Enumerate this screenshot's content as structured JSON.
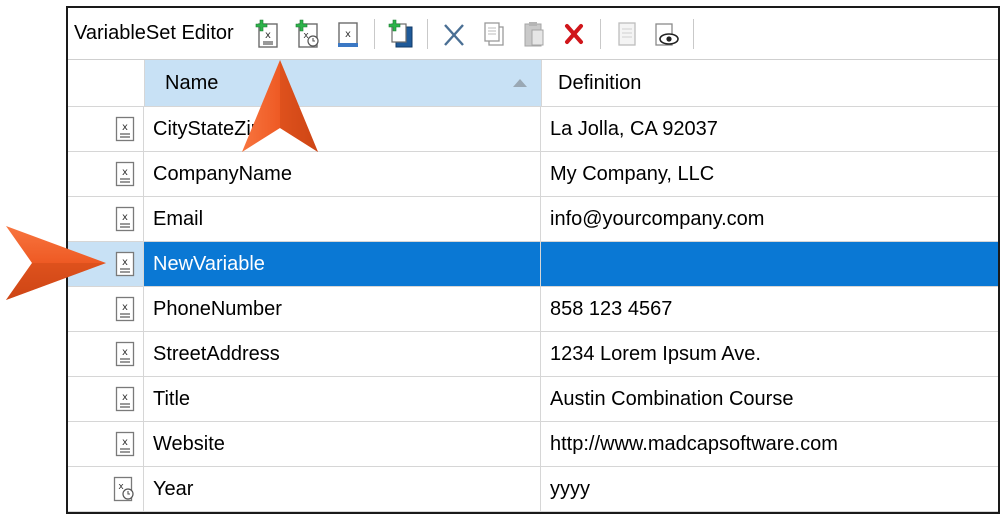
{
  "editor": {
    "title": "VariableSet Editor"
  },
  "toolbar": {
    "buttons": [
      {
        "icon": "add-variable-icon"
      },
      {
        "icon": "add-datetime-variable-icon"
      },
      {
        "icon": "edit-variable-icon"
      },
      {
        "icon": "import-variables-icon"
      },
      {
        "icon": "cut-icon"
      },
      {
        "icon": "copy-icon"
      },
      {
        "icon": "paste-icon"
      },
      {
        "icon": "delete-icon"
      },
      {
        "icon": "properties-icon"
      },
      {
        "icon": "preview-icon"
      }
    ]
  },
  "table": {
    "columns": {
      "name": "Name",
      "definition": "Definition"
    },
    "sorted_column": "Name",
    "sort_direction": "ascending",
    "rows": [
      {
        "name": "CityStateZip",
        "definition": "La Jolla, CA 92037",
        "icon": "text-variable-icon"
      },
      {
        "name": "CompanyName",
        "definition": "My Company, LLC",
        "icon": "text-variable-icon"
      },
      {
        "name": "Email",
        "definition": "info@yourcompany.com",
        "icon": "text-variable-icon"
      },
      {
        "name": "NewVariable",
        "definition": "",
        "icon": "text-variable-icon",
        "selected": true
      },
      {
        "name": "PhoneNumber",
        "definition": "858 123 4567",
        "icon": "text-variable-icon"
      },
      {
        "name": "StreetAddress",
        "definition": "1234 Lorem Ipsum Ave.",
        "icon": "text-variable-icon"
      },
      {
        "name": "Title",
        "definition": "Austin Combination Course",
        "icon": "text-variable-icon"
      },
      {
        "name": "Website",
        "definition": "http://www.madcapsoftware.com",
        "icon": "text-variable-icon"
      },
      {
        "name": "Year",
        "definition": "yyyy",
        "icon": "datetime-variable-icon"
      }
    ]
  },
  "colors": {
    "accent_arrow": "#ee5a24",
    "selection": "#0a78d4",
    "header_highlight": "#c8e1f5"
  }
}
